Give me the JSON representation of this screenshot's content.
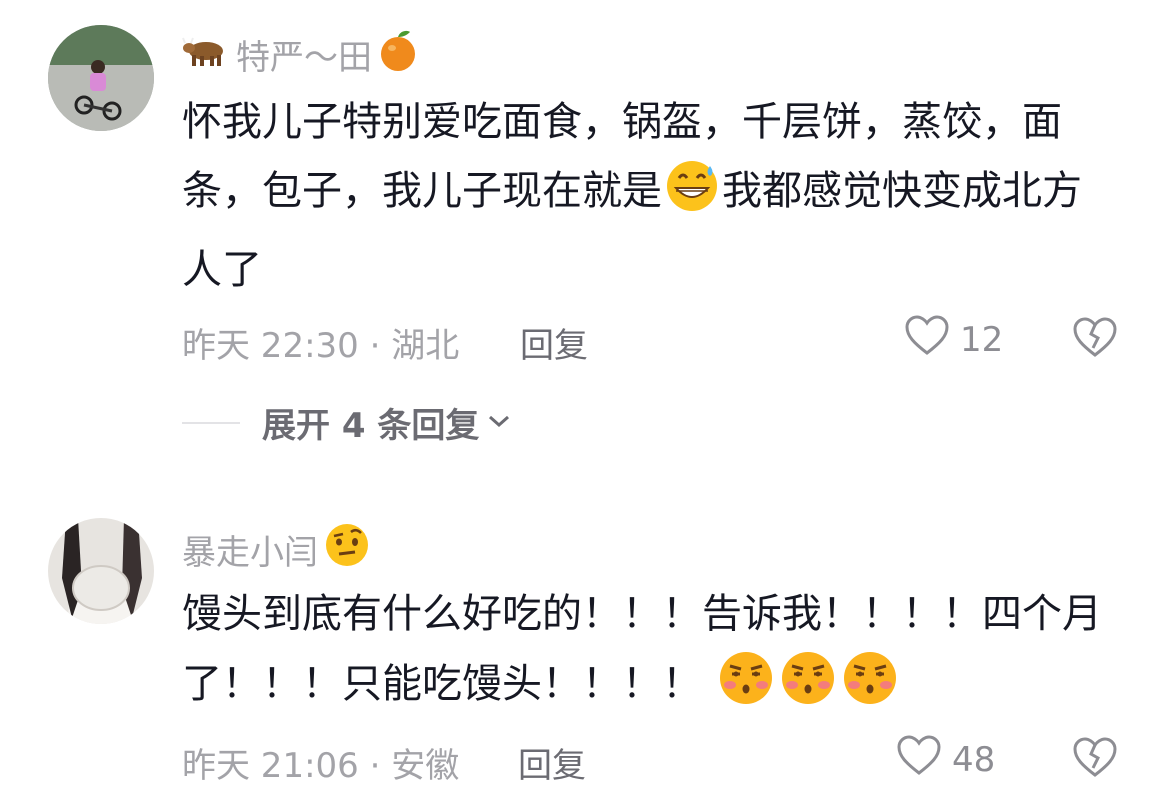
{
  "comments": [
    {
      "username": "特严～田",
      "username_prefix_emoji": "cow-emoji-icon",
      "username_suffix_emoji": "tangerine-emoji-icon",
      "text_part1": "怀我儿子特别爱吃面食，锅盔，千层饼，蒸饺，面条，包子，我儿子现在就是",
      "text_emoji": "grinning-sweat-emoji-icon",
      "text_part2": "我都感觉快变成北方人了",
      "time_location": "昨天 22:30 · 湖北",
      "reply_label": "回复",
      "likes": "12"
    },
    {
      "username": "暴走小闫",
      "username_suffix_emoji": "raised-eyebrow-emoji-icon",
      "text_part1": "馒头到底有什么好吃的！！！告诉我！！！！四个月了！！！只能吃馒头！！！！",
      "text_emojis": [
        "unamused-blush-emoji-icon",
        "unamused-blush-emoji-icon",
        "unamused-blush-emoji-icon"
      ],
      "time_location": "昨天 21:06 · 安徽",
      "reply_label": "回复",
      "likes": "48"
    }
  ],
  "expand_replies_label": "展开 4 条回复"
}
